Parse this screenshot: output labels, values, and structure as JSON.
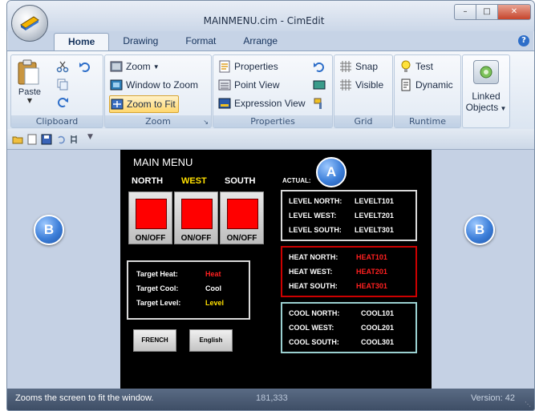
{
  "window": {
    "title": "MAINMENU.cim - CimEdit"
  },
  "tabs": [
    "Home",
    "Drawing",
    "Format",
    "Arrange"
  ],
  "ribbon": {
    "clipboard": {
      "label": "Clipboard",
      "paste": "Paste"
    },
    "zoom": {
      "label": "Zoom",
      "zoom": "Zoom",
      "window_to_zoom": "Window to Zoom",
      "zoom_to_fit": "Zoom to Fit"
    },
    "properties": {
      "label": "Properties",
      "properties": "Properties",
      "point_view": "Point View",
      "expression_view": "Expression View"
    },
    "grid": {
      "label": "Grid",
      "snap": "Snap",
      "visible": "Visible"
    },
    "runtime": {
      "label": "Runtime",
      "test": "Test",
      "dynamic": "Dynamic"
    },
    "linked": {
      "line1": "Linked",
      "line2": "Objects"
    }
  },
  "screen": {
    "title": "MAIN MENU",
    "zones": [
      "NORTH",
      "WEST",
      "SOUTH"
    ],
    "onoff": "ON/OFF",
    "actual": "ACTUAL:",
    "targets": [
      {
        "label": "Target Heat:",
        "value": "Heat"
      },
      {
        "label": "Target Cool:",
        "value": "Cool"
      },
      {
        "label": "Target Level:",
        "value": "Level"
      }
    ],
    "buttons": {
      "french": "FRENCH",
      "english": "English"
    },
    "levels": [
      {
        "label": "LEVEL NORTH:",
        "value": "LEVELT101"
      },
      {
        "label": "LEVEL WEST:",
        "value": "LEVELT201"
      },
      {
        "label": "LEVEL SOUTH:",
        "value": "LEVELT301"
      }
    ],
    "heats": [
      {
        "label": "HEAT NORTH:",
        "value": "HEAT101"
      },
      {
        "label": "HEAT WEST:",
        "value": "HEAT201"
      },
      {
        "label": "HEAT SOUTH:",
        "value": "HEAT301"
      }
    ],
    "cools": [
      {
        "label": "COOL NORTH:",
        "value": "COOL101"
      },
      {
        "label": "COOL WEST:",
        "value": "COOL201"
      },
      {
        "label": "COOL SOUTH:",
        "value": "COOL301"
      }
    ]
  },
  "markers": {
    "a": "A",
    "b": "B"
  },
  "statusbar": {
    "message": "Zooms the screen to fit the window.",
    "coords": "181,333",
    "version": "Version: 42"
  },
  "colors": {
    "accent_yellow": "#ffe000",
    "red": "#ff2020",
    "heat_box": "#cc0000",
    "cool_box": "#9ad0d0"
  }
}
